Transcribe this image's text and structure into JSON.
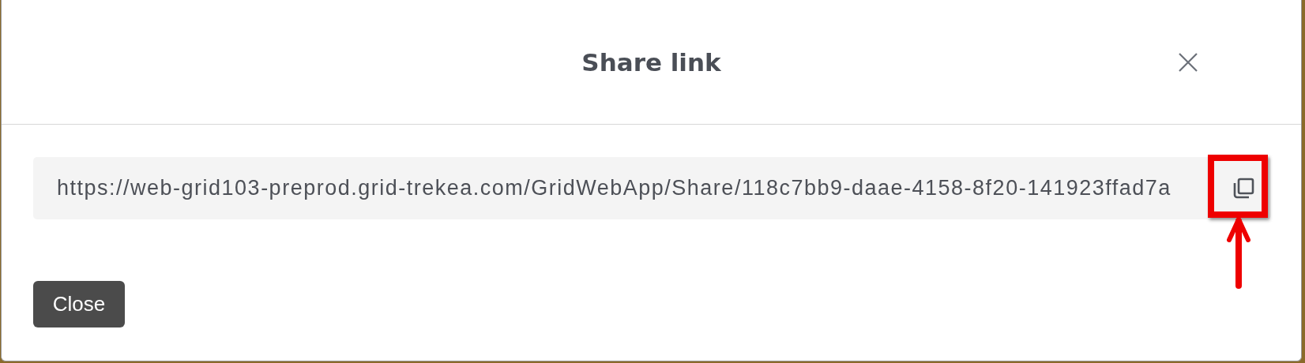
{
  "dialog": {
    "title": "Share link",
    "link": "https://web-grid103-preprod.grid-trekea.com/GridWebApp/Share/118c7bb9-daae-4158-8f20-141923ffad7a",
    "buttons": [
      "Close"
    ]
  },
  "annotation": {
    "highlight": true
  }
}
